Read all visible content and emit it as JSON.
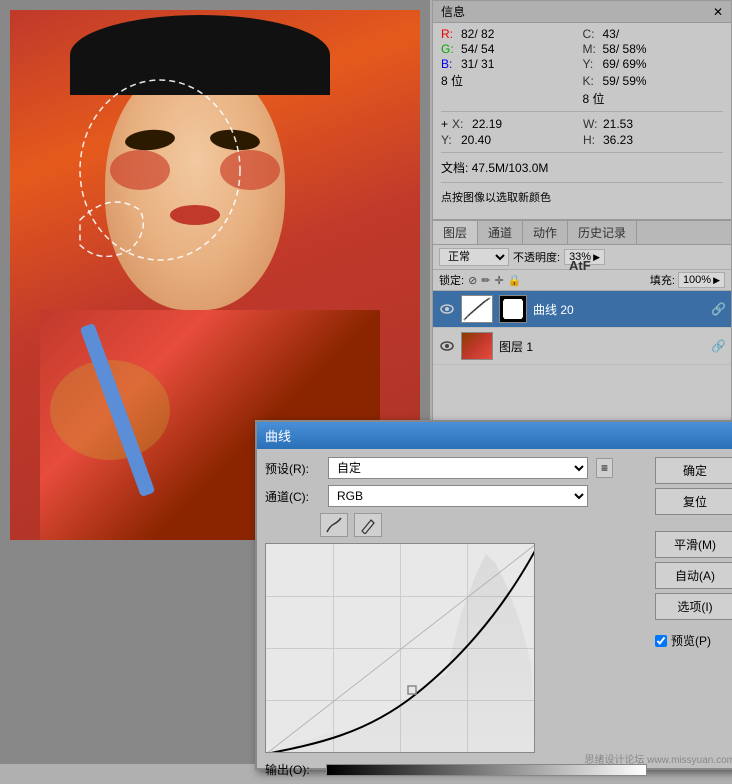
{
  "info_panel": {
    "title": "信息",
    "r_label": "R:",
    "r_value": "82/ 82",
    "g_label": "G:",
    "g_value": "54/ 54",
    "b_label": "B:",
    "b_value": "31/ 31",
    "bit_label": "8 位",
    "c_label": "C:",
    "c_value": "43/",
    "m_label": "M:",
    "m_value": "58/ 58%",
    "y_label": "Y:",
    "y_value": "69/ 69%",
    "k_label": "K:",
    "k_value": "59/ 59%",
    "bit2_label": "8 位",
    "x_label": "X:",
    "x_value": "22.19",
    "y_coord_label": "Y:",
    "y_coord_value": "20.40",
    "w_label": "W:",
    "w_value": "21.53",
    "h_label": "H:",
    "h_value": "36.23",
    "doc_label": "文档: 47.5M/103.0M",
    "hint": "点按图像以选取新颜色"
  },
  "layers_panel": {
    "tabs": [
      "图层",
      "通道",
      "动作",
      "历史记录"
    ],
    "blend_mode": "正常",
    "opacity_label": "不透明度:",
    "opacity_value": "33%",
    "lock_label": "锁定:",
    "fill_label": "填充:",
    "fill_value": "100%",
    "layers": [
      {
        "name": "曲线 20",
        "type": "curves",
        "visible": true,
        "active": true,
        "linked": true
      },
      {
        "name": "图层 1",
        "type": "photo",
        "visible": true,
        "active": false,
        "linked": true
      }
    ]
  },
  "curves_dialog": {
    "title": "曲线",
    "preset_label": "预设(R):",
    "preset_value": "自定",
    "channel_label": "通道(C):",
    "channel_value": "RGB",
    "buttons": {
      "ok": "确定",
      "reset": "复位",
      "smooth": "平滑(M)",
      "auto": "自动(A)",
      "options": "选项(I)",
      "preview_label": "预览(P)"
    },
    "output_label": "输出(O):",
    "watermark": "思绪设计论坛 www.missyuan.com"
  }
}
